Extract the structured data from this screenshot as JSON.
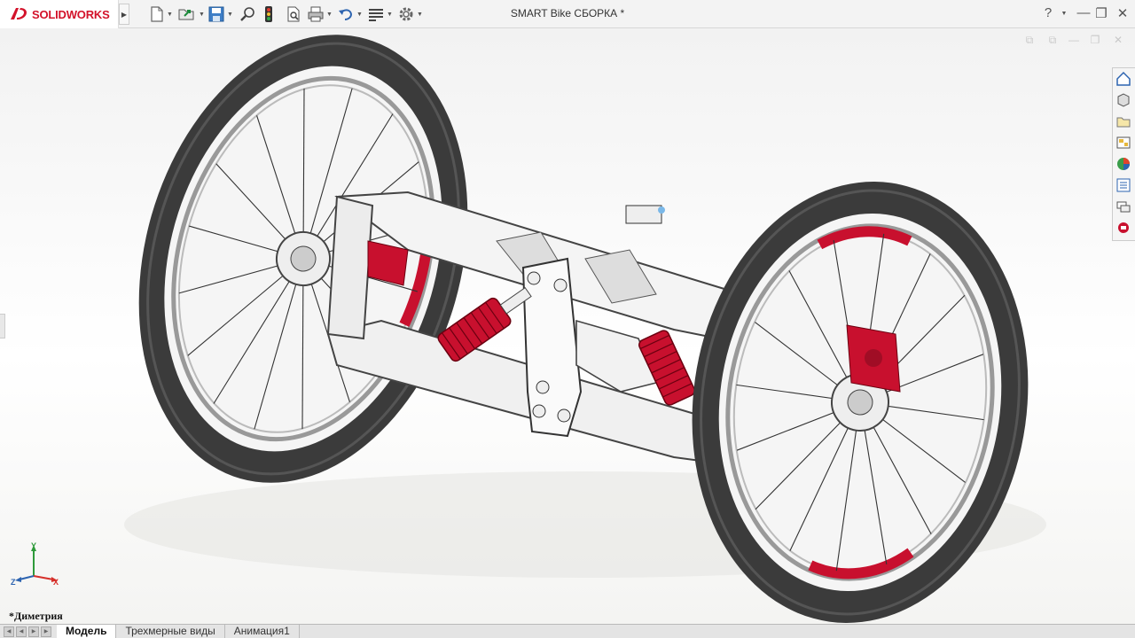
{
  "app": {
    "logo_text": "SOLIDWORKS",
    "document_title": "SMART Bike СБОРКА *"
  },
  "toolbar": {
    "icons": [
      "new-document-icon",
      "open-icon",
      "save-icon",
      "zoom-icon",
      "traffic-light-icon",
      "print-preview-icon",
      "print-icon",
      "undo-icon",
      "select-icon",
      "options-gear-icon"
    ]
  },
  "window_controls": {
    "help": "?",
    "pin": "📌",
    "minimize": "—",
    "restore": "❐",
    "close": "✕"
  },
  "viewport": {
    "view_name": "*Диметрия",
    "triad": {
      "y": "Y",
      "x": "X",
      "z": "Z"
    },
    "colors": {
      "accent_red": "#c8102e",
      "frame": "#f4f4f4",
      "tire": "#3a3a3a"
    }
  },
  "taskpane": {
    "icons": [
      "home-icon",
      "3d-parts-icon",
      "file-explorer-icon",
      "view-palette-icon",
      "appearances-icon",
      "custom-properties-icon",
      "forum-icon",
      "addin-icon"
    ]
  },
  "tabs": [
    {
      "label": "Модель",
      "active": true
    },
    {
      "label": "Трехмерные виды",
      "active": false
    },
    {
      "label": "Анимация1",
      "active": false
    }
  ]
}
